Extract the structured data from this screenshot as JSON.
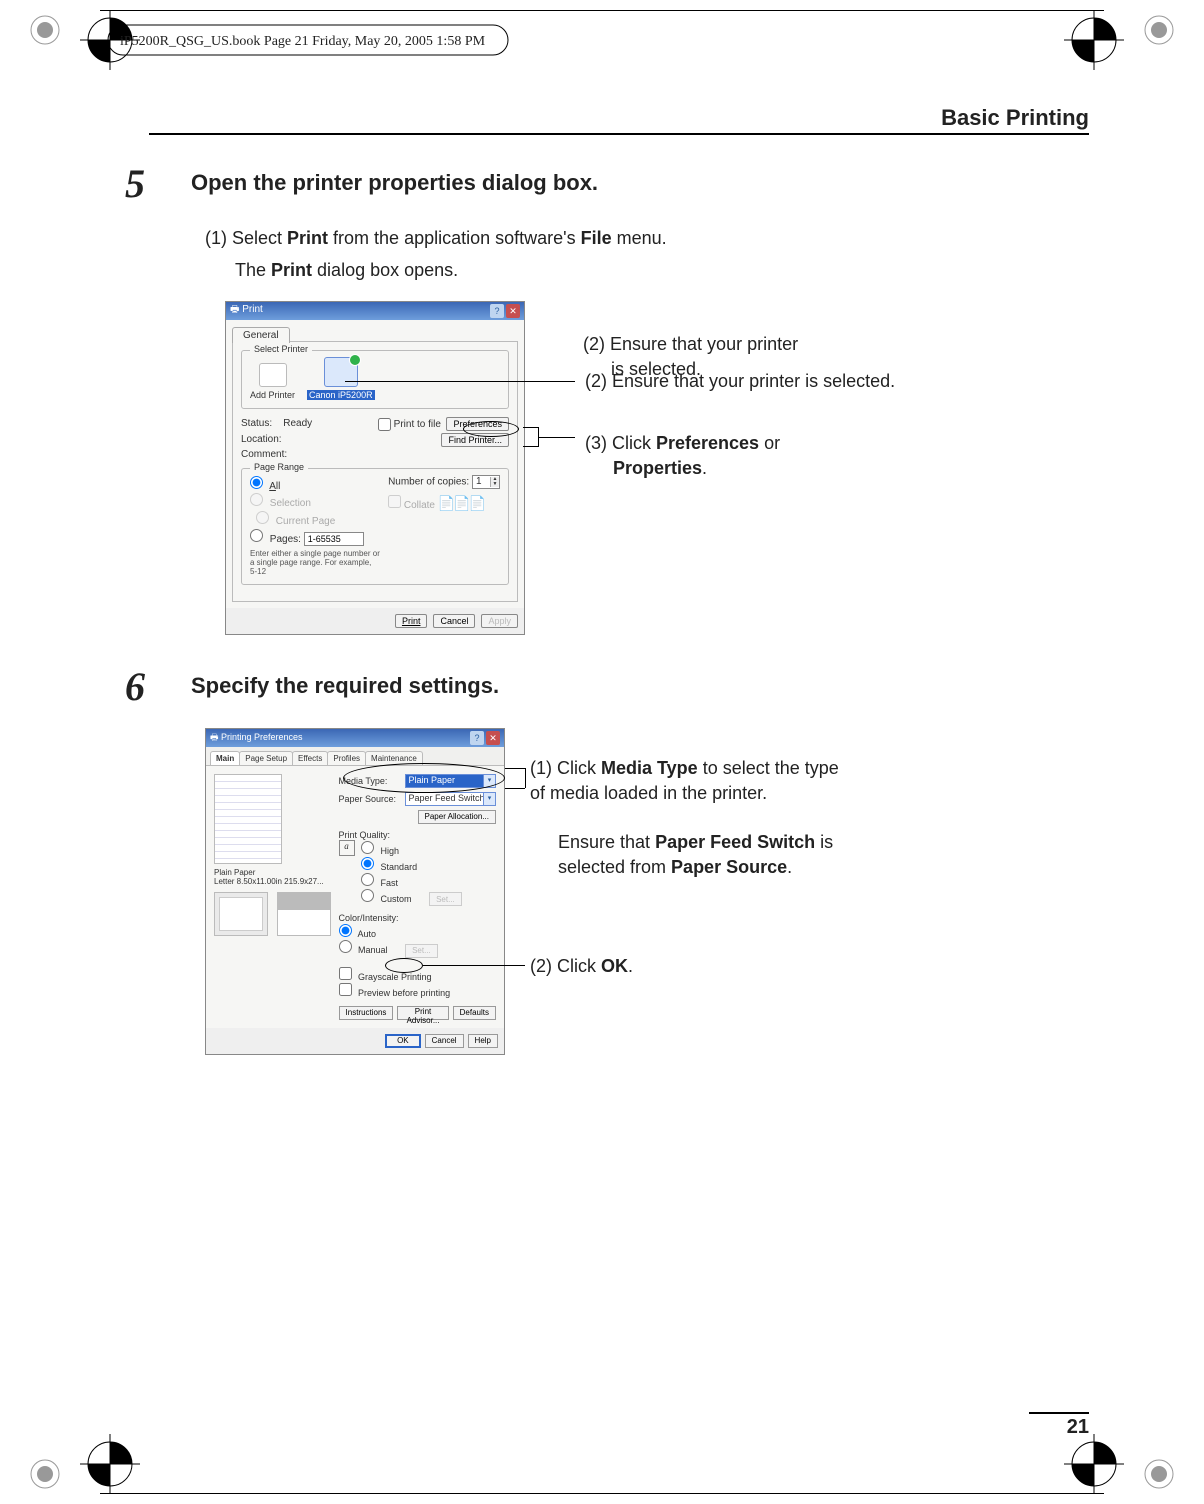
{
  "header_note": "iP5200R_QSG_US.book  Page 21  Friday, May 20, 2005  1:58 PM",
  "section_header": "Basic Printing",
  "page_number": "21",
  "step5": {
    "num": "5",
    "title": "Open the printer properties dialog box.",
    "sub1_prefix": "(1) Select ",
    "sub1_bold1": "Print",
    "sub1_mid": " from the application software's ",
    "sub1_bold2": "File",
    "sub1_suffix": " menu.",
    "sub2_prefix": "The ",
    "sub2_bold": "Print",
    "sub2_suffix": " dialog box opens."
  },
  "print_dialog": {
    "title": "Print",
    "tab_general": "General",
    "group_select_printer": "Select Printer",
    "add_printer": "Add Printer",
    "selected_printer": "Canon iP5200R",
    "status_label": "Status:",
    "status_value": "Ready",
    "location_label": "Location:",
    "comment_label": "Comment:",
    "print_to_file": "Print to file",
    "preferences_btn": "Preferences",
    "find_printer_btn": "Find Printer...",
    "group_page_range": "Page Range",
    "opt_all": "All",
    "opt_selection": "Selection",
    "opt_current": "Current Page",
    "opt_pages": "Pages:",
    "pages_value": "1-65535",
    "pages_hint": "Enter either a single page number or a single page range.  For example, 5-12",
    "copies_label": "Number of copies:",
    "copies_value": "1",
    "collate": "Collate",
    "btn_print": "Print",
    "btn_cancel": "Cancel",
    "btn_apply": "Apply"
  },
  "callouts5": {
    "c2": "(2) Ensure that your printer is selected.",
    "c3_a": "(3) Click ",
    "c3_b1": "Preferences",
    "c3_mid": " or ",
    "c3_b2": "Properties",
    "c3_end": "."
  },
  "step6": {
    "num": "6",
    "title": "Specify the required settings."
  },
  "pref_dialog": {
    "title": "Printing Preferences",
    "tabs": [
      "Main",
      "Page Setup",
      "Effects",
      "Profiles",
      "Maintenance"
    ],
    "media_type_label": "Media Type:",
    "media_type_value": "Plain Paper",
    "paper_source_label": "Paper Source:",
    "paper_source_value": "Paper Feed Switch",
    "paper_allocation_btn": "Paper Allocation...",
    "paper_info1": "Plain Paper",
    "paper_info2": "Letter 8.50x11.00in 215.9x27...",
    "print_quality_label": "Print Quality:",
    "pq_high": "High",
    "pq_standard": "Standard",
    "pq_fast": "Fast",
    "pq_custom": "Custom",
    "pq_set": "Set...",
    "ci_label": "Color/Intensity:",
    "ci_auto": "Auto",
    "ci_manual": "Manual",
    "ci_set": "Set...",
    "grayscale": "Grayscale Printing",
    "preview": "Preview before printing",
    "btn_instructions": "Instructions",
    "btn_advisor": "Print Advisor...",
    "btn_defaults": "Defaults",
    "btn_ok": "OK",
    "btn_cancel": "Cancel",
    "btn_help": "Help"
  },
  "callouts6": {
    "c1_a": "(1) Click ",
    "c1_b": "Media Type",
    "c1_c": " to select the type of media loaded in the printer.",
    "c1_d": "Ensure that ",
    "c1_e": "Paper Feed Switch",
    "c1_f": " is selected from ",
    "c1_g": "Paper Source",
    "c1_h": ".",
    "c2_a": "(2) Click ",
    "c2_b": "OK",
    "c2_c": "."
  }
}
